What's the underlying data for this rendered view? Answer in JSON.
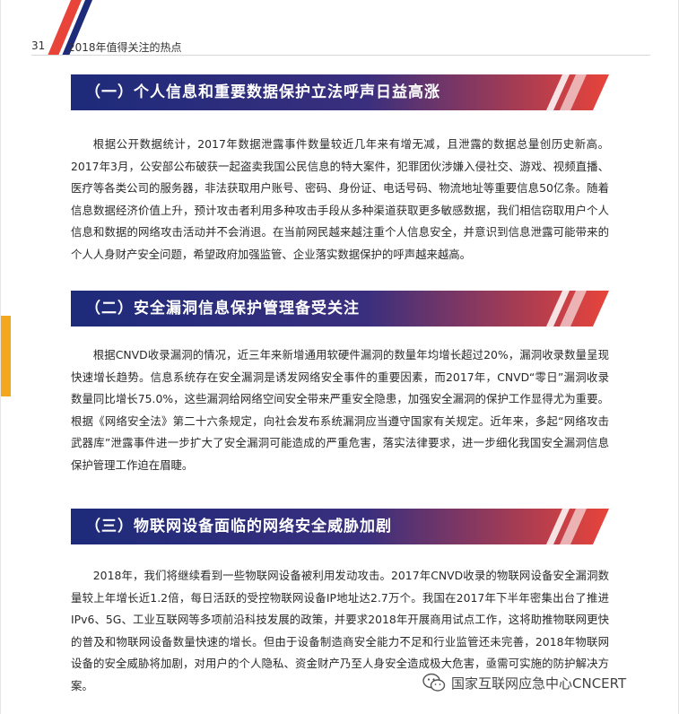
{
  "header": {
    "page_number": "31",
    "running_title": "2018年值得关注的热点"
  },
  "sections": [
    {
      "title": "（一）个人信息和重要数据保护立法呼声日益高涨",
      "body": "根据公开数据统计，2017年数据泄露事件数量较近几年来有增无减，且泄露的数据总量创历史新高。2017年3月，公安部公布破获一起盗卖我国公民信息的特大案件，犯罪团伙涉嫌入侵社交、游戏、视频直播、医疗等各类公司的服务器，非法获取用户账号、密码、身份证、电话号码、物流地址等重要信息50亿条。随着信息数据经济价值上升，预计攻击者利用多种攻击手段从多种渠道获取更多敏感数据，我们相信窃取用户个人信息和数据的网络攻击活动并不会消退。在当前网民越来越注重个人信息安全，并意识到信息泄露可能带来的个人人身财产安全问题，希望政府加强监管、企业落实数据保护的呼声越来越高。"
    },
    {
      "title": "（二）安全漏洞信息保护管理备受关注",
      "body": "根据CNVD收录漏洞的情况，近三年来新增通用软硬件漏洞的数量年均增长超过20%，漏洞收录数量呈现快速增长趋势。信息系统存在安全漏洞是诱发网络安全事件的重要因素，而2017年，CNVD“零日”漏洞收录数量同比增长75.0%，这些漏洞给网络空间安全带来严重安全隐患，加强安全漏洞的保护工作显得尤为重要。根据《网络安全法》第二十六条规定，向社会发布系统漏洞应当遵守国家有关规定。近年来，多起“网络攻击武器库”泄露事件进一步扩大了安全漏洞可能造成的严重危害，落实法律要求，进一步细化我国安全漏洞信息保护管理工作迫在眉睫。"
    },
    {
      "title": "（三）物联网设备面临的网络安全威胁加剧",
      "body": "2018年，我们将继续看到一些物联网设备被利用发动攻击。2017年CNVD收录的物联网设备安全漏洞数量较上年增长近1.2倍，每日活跃的受控物联网设备IP地址达2.7万个。我国在2017年下半年密集出台了推进IPv6、5G、工业互联网等多项前沿科技发展的政策，并要求2018年开展商用试点工作，这将助推物联网更快的普及和物联网设备数量快速的增长。但由于设备制造商安全能力不足和行业监管还未完善，2018年物联网设备的安全威胁将加剧，对用户的个人隐私、资金财产乃至人身安全造成极大危害，亟需可实施的防护解决方案。"
    }
  ],
  "watermark": {
    "icon": "wechat-icon",
    "text": "国家互联网应急中心CNCERT"
  },
  "colors": {
    "banner_start": "#1d2b7a",
    "banner_end": "#e8443a",
    "accent": "#e8443a",
    "side_tab": "#f2a71c"
  }
}
